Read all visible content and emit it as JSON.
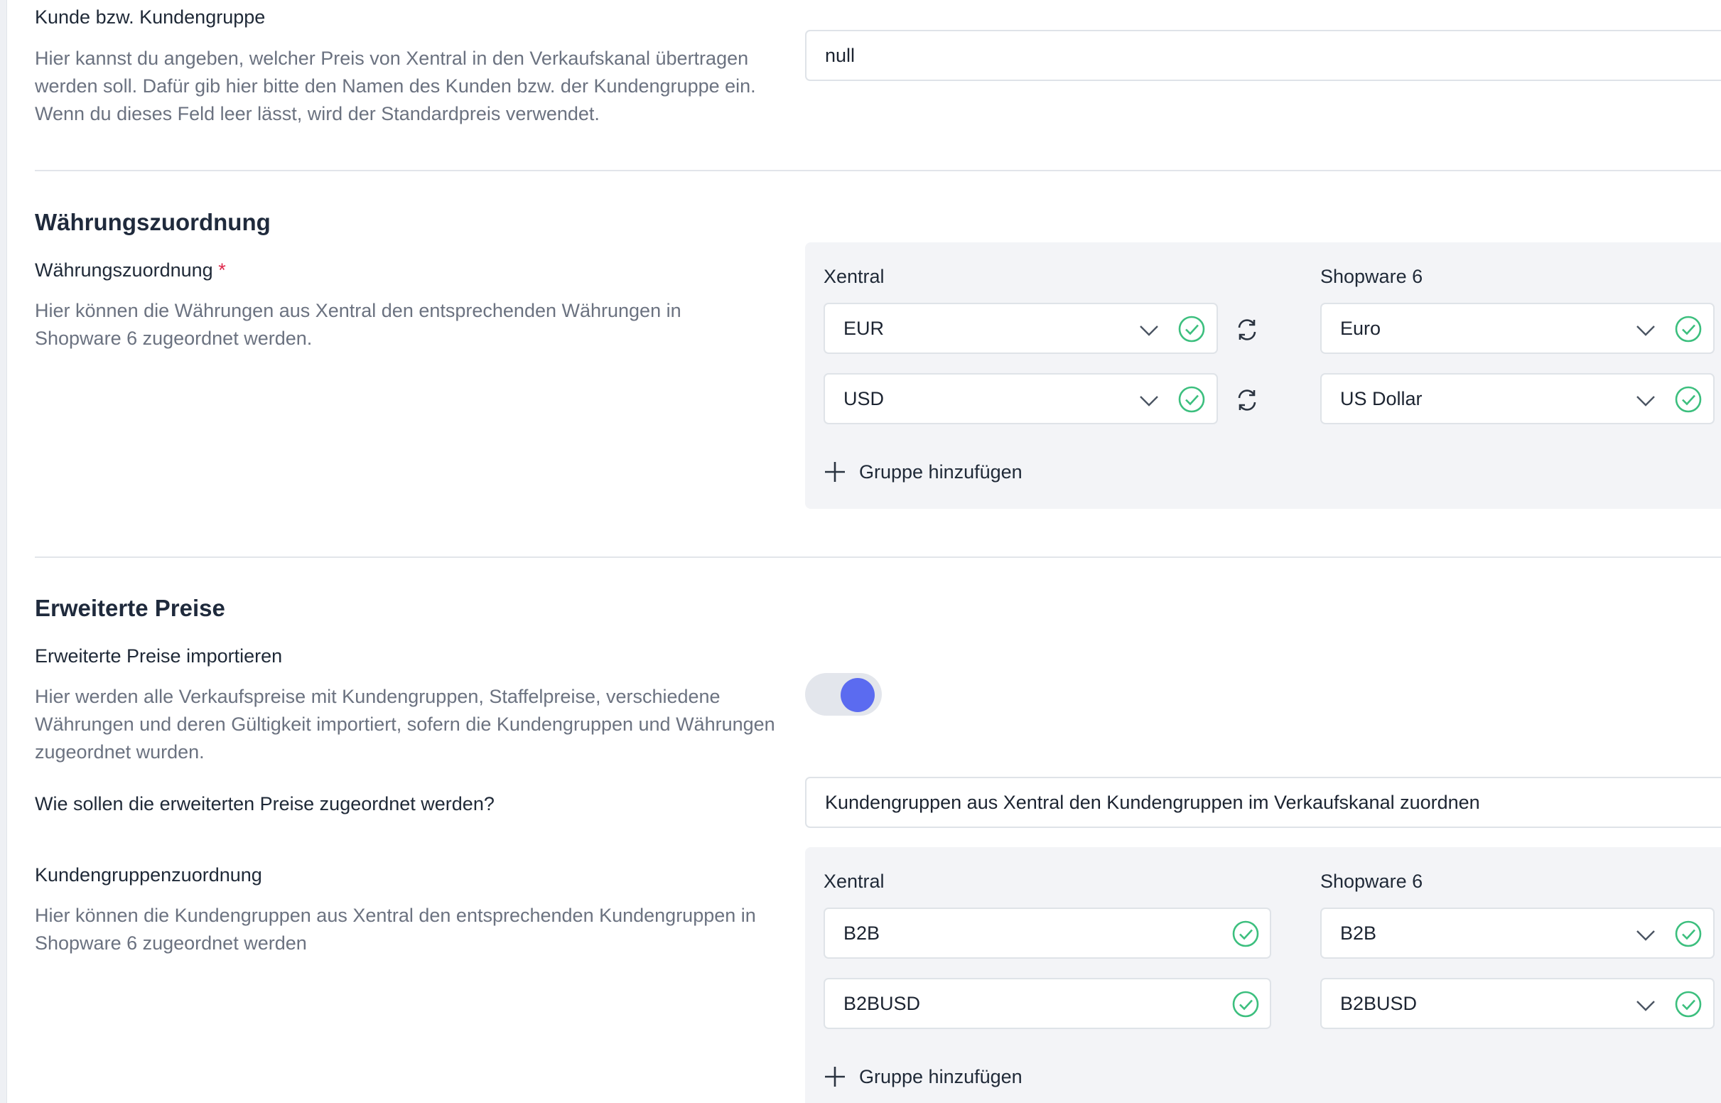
{
  "customer_group": {
    "label": "Kunde bzw. Kundengruppe",
    "description": "Hier kannst du angeben, welcher Preis von Xentral in den Verkaufskanal übertragen werden soll. Dafür gib hier bitte den Namen des Kunden bzw. der Kundengruppe ein. Wenn du dieses Feld leer lässt, wird der Standardpreis verwendet.",
    "value": "null"
  },
  "currency_section": {
    "title": "Währungszuordnung",
    "field_label": "Währungszuordnung",
    "required_marker": "*",
    "description": "Hier können die Währungen aus Xentral den entsprechenden Währungen in Shopware 6 zugeordnet werden.",
    "left_header": "Xentral",
    "right_header": "Shopware 6",
    "rows": [
      {
        "xentral": "EUR",
        "shopware": "Euro"
      },
      {
        "xentral": "USD",
        "shopware": "US Dollar"
      }
    ],
    "add_group_label": "Gruppe hinzufügen"
  },
  "advanced_prices": {
    "title": "Erweiterte Preise",
    "import_label": "Erweiterte Preise importieren",
    "import_description": "Hier werden alle Verkaufspreise mit Kundengruppen, Staffelpreise, verschiedene Währungen und deren Gültigkeit importiert, sofern die Kundengruppen und Währungen zugeordnet wurden.",
    "import_enabled": true,
    "mapping_question": "Wie sollen die erweiterten Preise zugeordnet werden?",
    "mapping_value": "Kundengruppen aus Xentral den Kundengruppen im Verkaufskanal zuordnen"
  },
  "customer_group_mapping": {
    "label": "Kundengruppenzuordnung",
    "description": "Hier können die Kundengruppen aus Xentral den entsprechenden Kundengruppen in Shopware 6 zugeordnet werden",
    "left_header": "Xentral",
    "right_header": "Shopware 6",
    "rows": [
      {
        "xentral": "B2B",
        "shopware": "B2B"
      },
      {
        "xentral": "B2BUSD",
        "shopware": "B2BUSD"
      }
    ],
    "add_group_label": "Gruppe hinzufügen"
  },
  "colors": {
    "success": "#3cbf7e",
    "toggle_knob": "#5b6bf0",
    "required": "#de294c"
  },
  "icons": [
    "chevron-down-icon",
    "check-circle-icon",
    "swap-icon",
    "plus-icon"
  ]
}
